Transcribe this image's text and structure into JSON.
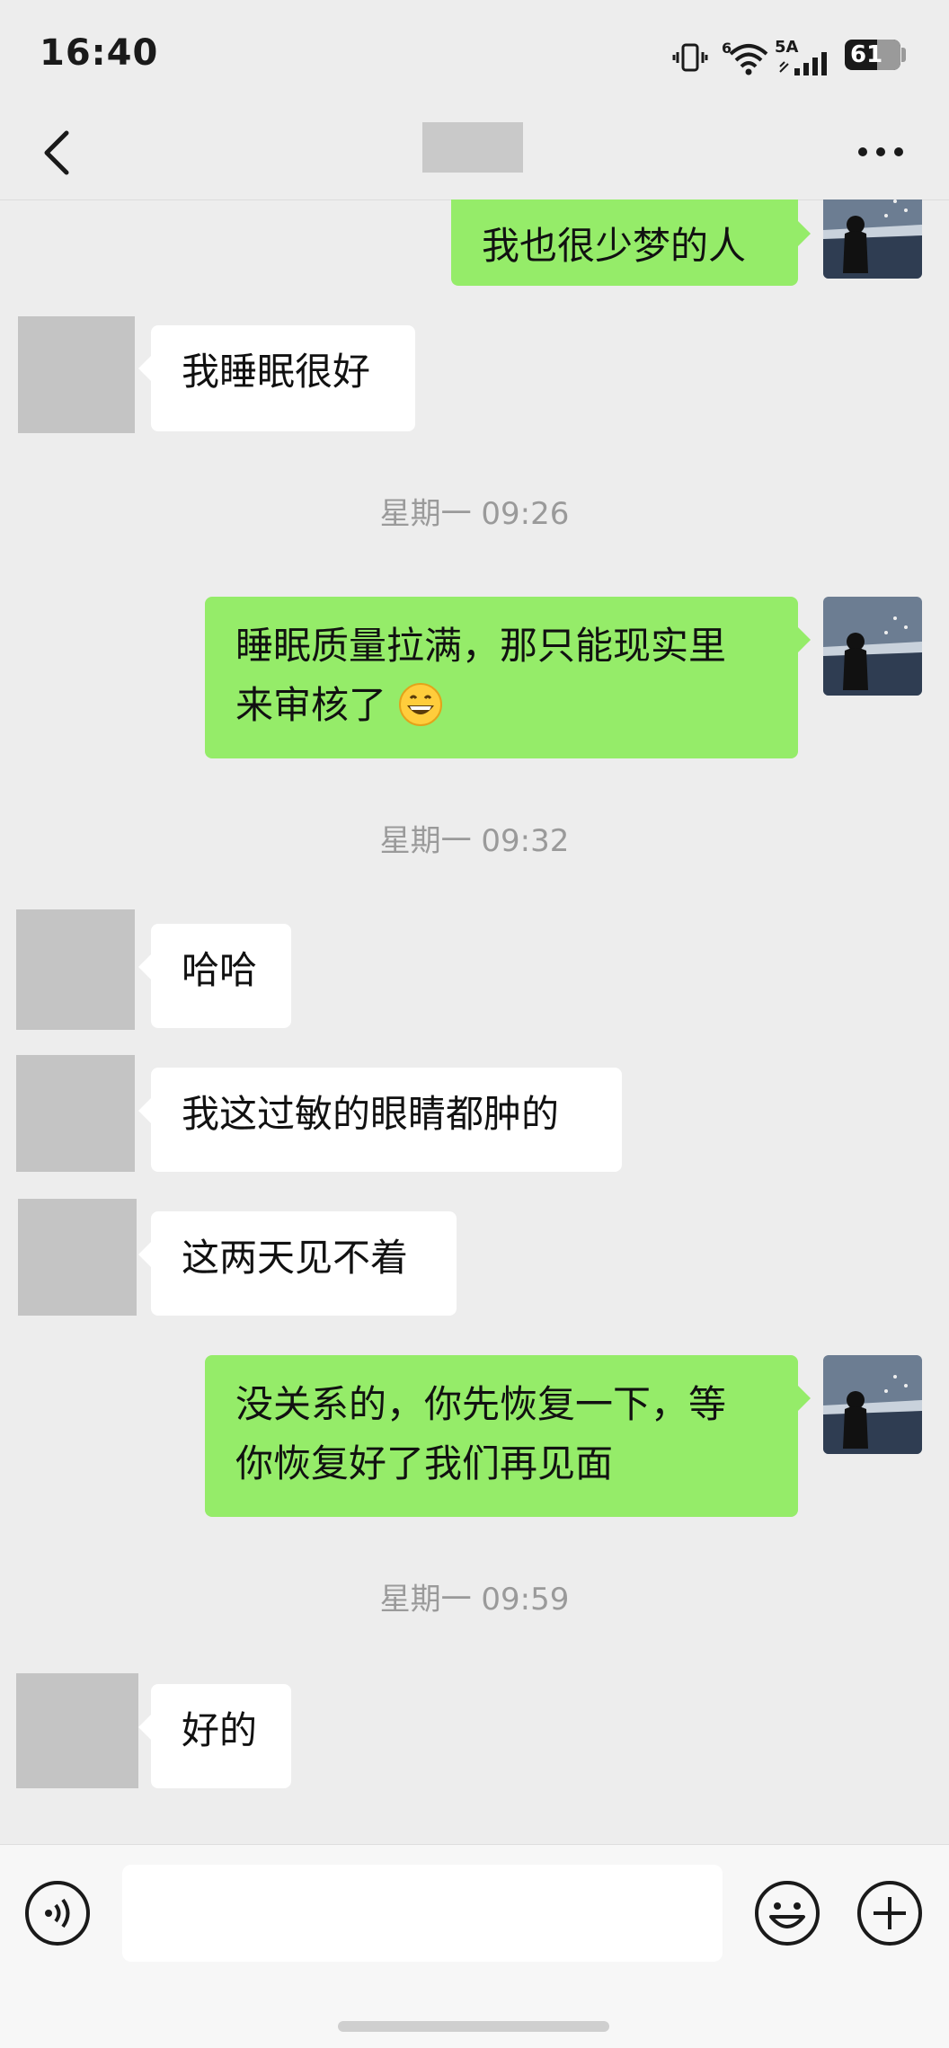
{
  "status_bar": {
    "time": "16:40",
    "network_label": "5A",
    "wifi_label": "6",
    "battery_level": "61"
  },
  "header": {
    "title": "",
    "back_icon": "chevron-left-icon",
    "more_icon": "more-horizontal-icon"
  },
  "messages": [
    {
      "direction": "out",
      "text": "我也很少梦的人"
    },
    {
      "direction": "in",
      "text": "我睡眠很好"
    },
    {
      "type": "time",
      "text": "星期一 09:26"
    },
    {
      "direction": "out",
      "lines": [
        "睡眠质量拉满，那只能现实里",
        "来审核了"
      ],
      "emoji": "grinning-face-icon"
    },
    {
      "type": "time",
      "text": "星期一 09:32"
    },
    {
      "direction": "in",
      "text": "哈哈"
    },
    {
      "direction": "in",
      "text": "我这过敏的眼睛都肿的"
    },
    {
      "direction": "in",
      "text": "这两天见不着"
    },
    {
      "direction": "out",
      "lines": [
        "没关系的，你先恢复一下，等",
        "你恢复好了我们再见面"
      ]
    },
    {
      "type": "time",
      "text": "星期一 09:59"
    },
    {
      "direction": "in",
      "text": "好的"
    }
  ],
  "input_bar": {
    "voice_icon": "voice-icon",
    "input_value": "",
    "emoji_icon": "smiley-icon",
    "plus_icon": "plus-circle-icon"
  },
  "colors": {
    "background": "#ededed",
    "outgoing_bubble": "#95ec69",
    "incoming_bubble": "#ffffff",
    "timestamp": "#9a9a9a"
  }
}
